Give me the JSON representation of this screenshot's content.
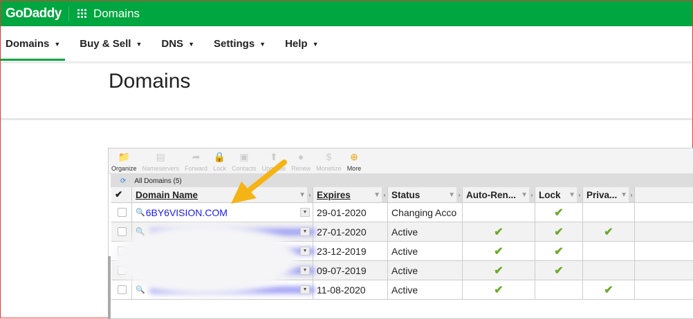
{
  "header": {
    "logo": "GoDaddy",
    "app_title": "Domains",
    "brand_color": "#00a63f"
  },
  "nav": [
    {
      "label": "Domains",
      "active": true
    },
    {
      "label": "Buy & Sell"
    },
    {
      "label": "DNS"
    },
    {
      "label": "Settings"
    },
    {
      "label": "Help"
    }
  ],
  "page_title": "Domains",
  "toolbar": [
    {
      "label": "Organize",
      "icon": "folder-icon",
      "enabled": true
    },
    {
      "label": "Nameservers",
      "icon": "server-icon",
      "enabled": false
    },
    {
      "label": "Forward",
      "icon": "forward-icon",
      "enabled": false
    },
    {
      "label": "Lock",
      "icon": "lock-icon",
      "enabled": false
    },
    {
      "label": "Contacts",
      "icon": "contact-card-icon",
      "enabled": false
    },
    {
      "label": "Upgrade",
      "icon": "upgrade-icon",
      "enabled": false
    },
    {
      "label": "Renew",
      "icon": "renew-icon",
      "enabled": false
    },
    {
      "label": "Monetize",
      "icon": "dollar-icon",
      "enabled": false
    },
    {
      "label": "More",
      "icon": "plus-circle-icon",
      "enabled": true
    }
  ],
  "filter_label": "All Domains (5)",
  "columns": [
    "Domain Name",
    "Expires",
    "Status",
    "Auto-Ren...",
    "Lock",
    "Priva..."
  ],
  "rows": [
    {
      "domain": "6BY6VISION.COM",
      "expires": "29-01-2020",
      "status": "Changing Acco",
      "auto_renew": false,
      "lock": true,
      "privacy": false
    },
    {
      "domain": "",
      "expires": "27-01-2020",
      "status": "Active",
      "auto_renew": true,
      "lock": true,
      "privacy": true
    },
    {
      "domain": "",
      "expires": "23-12-2019",
      "status": "Active",
      "auto_renew": true,
      "lock": true,
      "privacy": false
    },
    {
      "domain": "",
      "expires": "09-07-2019",
      "status": "Active",
      "auto_renew": true,
      "lock": true,
      "privacy": false
    },
    {
      "domain": "",
      "expires": "11-08-2020",
      "status": "Active",
      "auto_renew": true,
      "lock": false,
      "privacy": true
    }
  ],
  "annotation_arrow_color": "#f5b315"
}
